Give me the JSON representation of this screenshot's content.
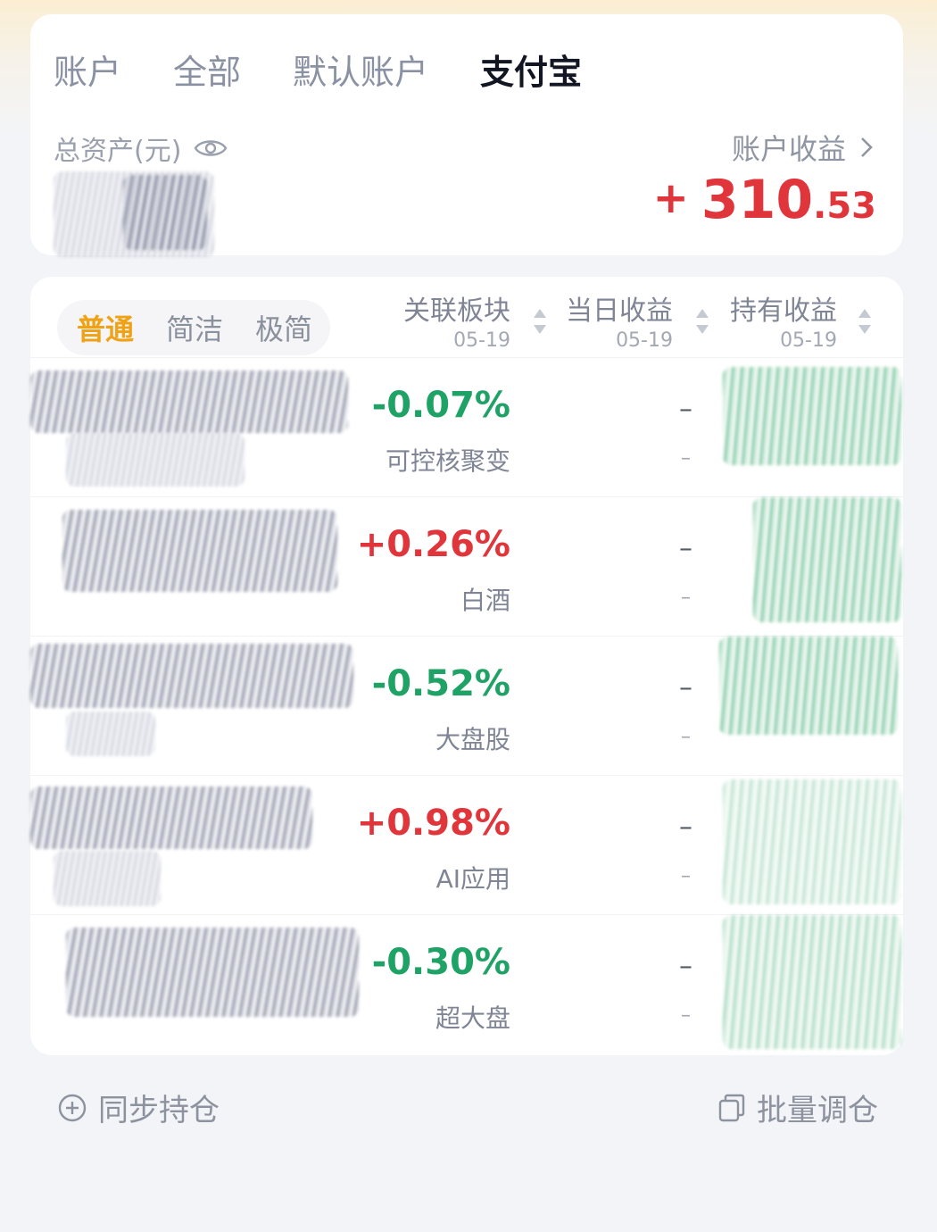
{
  "tabs": [
    {
      "label": "账户",
      "active": false
    },
    {
      "label": "全部",
      "active": false
    },
    {
      "label": "默认账户",
      "active": false
    },
    {
      "label": "支付宝",
      "active": true
    }
  ],
  "summary": {
    "total_assets_label": "总资产(元)",
    "account_profit_label": "账户收益",
    "profit_sign": "+",
    "profit_int": "310",
    "profit_dec": ".53",
    "profit_color": "#e0353b"
  },
  "view_modes": [
    {
      "label": "普通",
      "active": true
    },
    {
      "label": "简洁",
      "active": false
    },
    {
      "label": "极简",
      "active": false
    }
  ],
  "columns": [
    {
      "title": "关联板块",
      "date": "05-19"
    },
    {
      "title": "当日收益",
      "date": "05-19"
    },
    {
      "title": "持有收益",
      "date": "05-19"
    }
  ],
  "holdings": [
    {
      "sector_change": "-0.07%",
      "direction": "down",
      "sector": "可控核聚变",
      "daily_profit": "–",
      "daily_profit_rate": "–"
    },
    {
      "sector_change": "+0.26%",
      "direction": "up",
      "sector": "白酒",
      "daily_profit": "–",
      "daily_profit_rate": "–"
    },
    {
      "sector_change": "-0.52%",
      "direction": "down",
      "sector": "大盘股",
      "daily_profit": "–",
      "daily_profit_rate": "–"
    },
    {
      "sector_change": "+0.98%",
      "direction": "up",
      "sector": "AI应用",
      "daily_profit": "–",
      "daily_profit_rate": "–"
    },
    {
      "sector_change": "-0.30%",
      "direction": "down",
      "sector": "超大盘",
      "daily_profit": "–",
      "daily_profit_rate": "–"
    }
  ],
  "footer": {
    "sync_label": "同步持仓",
    "batch_label": "批量调仓"
  },
  "colors": {
    "up": "#e0353b",
    "down": "#1fa265",
    "accent": "#f0a216"
  },
  "icons": [
    "eye-icon",
    "chevron-right-icon",
    "sort-icon",
    "plus-circle-icon",
    "copy-icon"
  ]
}
